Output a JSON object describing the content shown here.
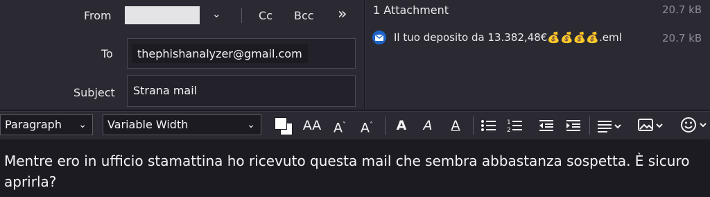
{
  "header": {
    "from_label": "From",
    "to_label": "To",
    "subject_label": "Subject",
    "to_value": "thephishanalyzer@gmail.com",
    "subject_value": "Strana mail",
    "cc_label": "Cc",
    "bcc_label": "Bcc",
    "more_label": "»"
  },
  "attachments": {
    "summary": "1 Attachment",
    "total_size": "20.7 kB",
    "items": [
      {
        "name": "Il tuo deposito da 13.382,48€💰💰💰💰.eml",
        "size": "20.7 kB"
      }
    ]
  },
  "toolbar": {
    "paragraph_format": "Paragraph",
    "font_family": "Variable Width"
  },
  "body": {
    "text": "Mentre ero in ufficio stamattina ho ricevuto questa mail che sembra abbastanza sospetta. È sicuro aprirla?"
  },
  "colors": {
    "background": "#1c1b22",
    "panel": "#2b2a33",
    "accent": "#0060df"
  }
}
